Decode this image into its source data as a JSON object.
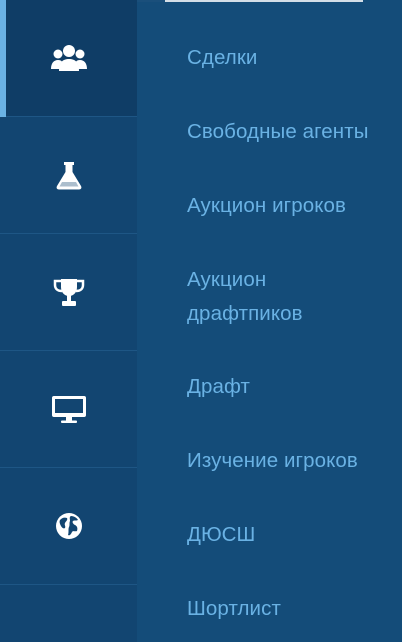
{
  "rail": {
    "tabs": [
      {
        "icon": "users-icon",
        "active": true
      },
      {
        "icon": "flask-icon",
        "active": false
      },
      {
        "icon": "trophy-icon",
        "active": false
      },
      {
        "icon": "monitor-icon",
        "active": false
      },
      {
        "icon": "globe-icon",
        "active": false
      }
    ]
  },
  "menu": {
    "items": [
      {
        "label": "Сделки"
      },
      {
        "label": "Свободные агенты"
      },
      {
        "label": "Аукцион игроков"
      },
      {
        "label_line1": "Аукцион",
        "label_line2": "драфтпиков"
      },
      {
        "label": "Драфт"
      },
      {
        "label": "Изучение игроков"
      },
      {
        "label": "ДЮСШ"
      },
      {
        "label": "Шортлист"
      }
    ]
  },
  "colors": {
    "panel_bg": "#144c79",
    "rail_bg": "#124571",
    "active_tab_bg": "#0f3d66",
    "accent": "#6ab2e4"
  }
}
